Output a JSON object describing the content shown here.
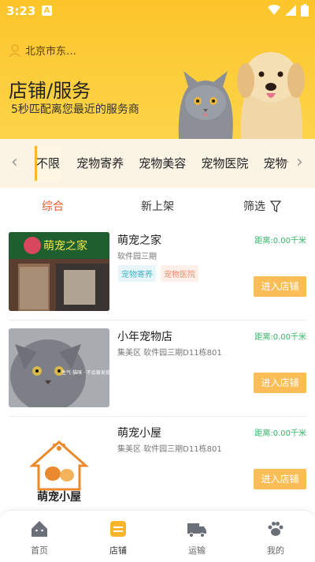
{
  "status": {
    "time": "3:23",
    "notif_badge": "A"
  },
  "header": {
    "location": "北京市东…",
    "title": "店铺/服务",
    "subtitle": "5秒匹配离您最近的服务商"
  },
  "categories": [
    "不限",
    "宠物寄养",
    "宠物美容",
    "宠物医院",
    "宠物训"
  ],
  "sort": {
    "all": "综合",
    "new": "新上架",
    "filter": "筛选"
  },
  "stores": [
    {
      "name": "萌宠之家",
      "address": "软件园三期",
      "distance": "距离:0.00千米",
      "tags": [
        "宠物寄养",
        "宠物医院"
      ],
      "button": "进入店铺",
      "shop_sign": "萌宠之家"
    },
    {
      "name": "小年宠物店",
      "address": "集美区 软件园三期D11栋801",
      "distance": "距离:0.00千米",
      "tags": [],
      "button": "进入店铺",
      "overlay": "生气·猫咪 · 不会被发现"
    },
    {
      "name": "萌宠小屋",
      "address": "集美区 软件园三期D11栋801",
      "distance": "距离:0.00千米",
      "tags": [],
      "button": "进入店铺",
      "logo_text": "萌宠小屋"
    }
  ],
  "tabbar": {
    "home": "首页",
    "stores": "店铺",
    "transport": "运输",
    "mine": "我的"
  },
  "colors": {
    "accent": "#fcc52a",
    "active_sort": "#e9592b",
    "distance": "#34b467",
    "button": "#fbbd55"
  }
}
